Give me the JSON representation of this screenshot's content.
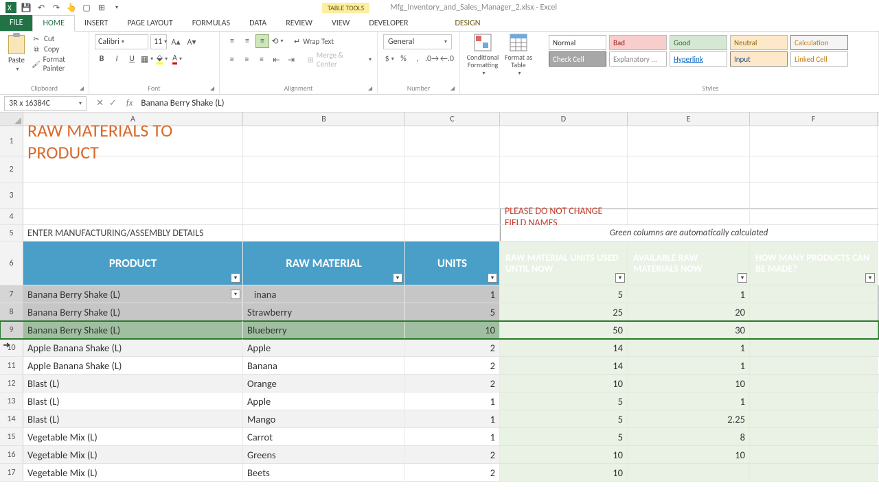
{
  "titlebar": {
    "table_tools": "TABLE TOOLS",
    "doc_title": "Mfg_Inventory_and_Sales_Manager_2.xlsx - Excel"
  },
  "tabs": {
    "file": "FILE",
    "home": "HOME",
    "insert": "INSERT",
    "page_layout": "PAGE LAYOUT",
    "formulas": "FORMULAS",
    "data": "DATA",
    "review": "REVIEW",
    "view": "VIEW",
    "developer": "DEVELOPER",
    "design": "DESIGN"
  },
  "ribbon": {
    "clipboard": {
      "paste": "Paste",
      "cut": "Cut",
      "copy": "Copy",
      "format_painter": "Format Painter",
      "label": "Clipboard"
    },
    "font": {
      "name": "Calibri",
      "size": "11",
      "label": "Font"
    },
    "alignment": {
      "wrap": "Wrap Text",
      "merge": "Merge & Center",
      "label": "Alignment"
    },
    "number": {
      "format": "General",
      "label": "Number"
    },
    "cond_fmt": "Conditional Formatting",
    "fmt_table": "Format as Table",
    "styles_label": "Styles",
    "styles": {
      "normal": "Normal",
      "bad": "Bad",
      "good": "Good",
      "neutral": "Neutral",
      "calculation": "Calculation",
      "check_cell": "Check Cell",
      "explanatory": "Explanatory ...",
      "hyperlink": "Hyperlink",
      "input": "Input",
      "linked_cell": "Linked Cell"
    }
  },
  "namebox": "3R x 16384C",
  "formula": "Banana Berry Shake (L)",
  "columns": [
    "A",
    "B",
    "C",
    "D",
    "E",
    "F"
  ],
  "sheet": {
    "title": "RAW MATERIALS TO PRODUCT",
    "warning": "PLEASE DO NOT CHANGE FIELD NAMES",
    "enter_details": "ENTER MANUFACTURING/ASSEMBLY DETAILS",
    "green_note": "Green columns are automatically calculated",
    "headers": {
      "product": "PRODUCT",
      "raw_material": "RAW MATERIAL",
      "units": "UNITS",
      "used": "RAW MATERIAL UNITS USED UNTIL NOW",
      "available": "AVAILABLE RAW MATERIALS NOW",
      "can_make": "HOW MANY PRODUCTS CAN BE MADE?"
    },
    "rows": [
      {
        "n": 7,
        "product": "Banana Berry Shake (L)",
        "raw": "Banana",
        "units": "1",
        "used": "5",
        "avail": "1",
        "make": ""
      },
      {
        "n": 8,
        "product": "Banana Berry Shake (L)",
        "raw": "Strawberry",
        "units": "5",
        "used": "25",
        "avail": "20",
        "make": ""
      },
      {
        "n": 9,
        "product": "Banana Berry Shake (L)",
        "raw": "Blueberry",
        "units": "10",
        "used": "50",
        "avail": "30",
        "make": ""
      },
      {
        "n": 10,
        "product": "Apple Banana Shake (L)",
        "raw": "Apple",
        "units": "2",
        "used": "14",
        "avail": "1",
        "make": ""
      },
      {
        "n": 11,
        "product": "Apple Banana Shake (L)",
        "raw": "Banana",
        "units": "2",
        "used": "14",
        "avail": "1",
        "make": ""
      },
      {
        "n": 12,
        "product": "Blast (L)",
        "raw": "Orange",
        "units": "2",
        "used": "10",
        "avail": "10",
        "make": ""
      },
      {
        "n": 13,
        "product": "Blast (L)",
        "raw": "Apple",
        "units": "1",
        "used": "5",
        "avail": "1",
        "make": ""
      },
      {
        "n": 14,
        "product": "Blast (L)",
        "raw": "Mango",
        "units": "1",
        "used": "5",
        "avail": "2.25",
        "make": ""
      },
      {
        "n": 15,
        "product": "Vegetable Mix (L)",
        "raw": "Carrot",
        "units": "1",
        "used": "5",
        "avail": "8",
        "make": ""
      },
      {
        "n": 16,
        "product": "Vegetable Mix (L)",
        "raw": "Greens",
        "units": "2",
        "used": "10",
        "avail": "10",
        "make": ""
      },
      {
        "n": 17,
        "product": "Vegetable Mix (L)",
        "raw": "Beets",
        "units": "2",
        "used": "10",
        "avail": "",
        "make": ""
      }
    ]
  }
}
